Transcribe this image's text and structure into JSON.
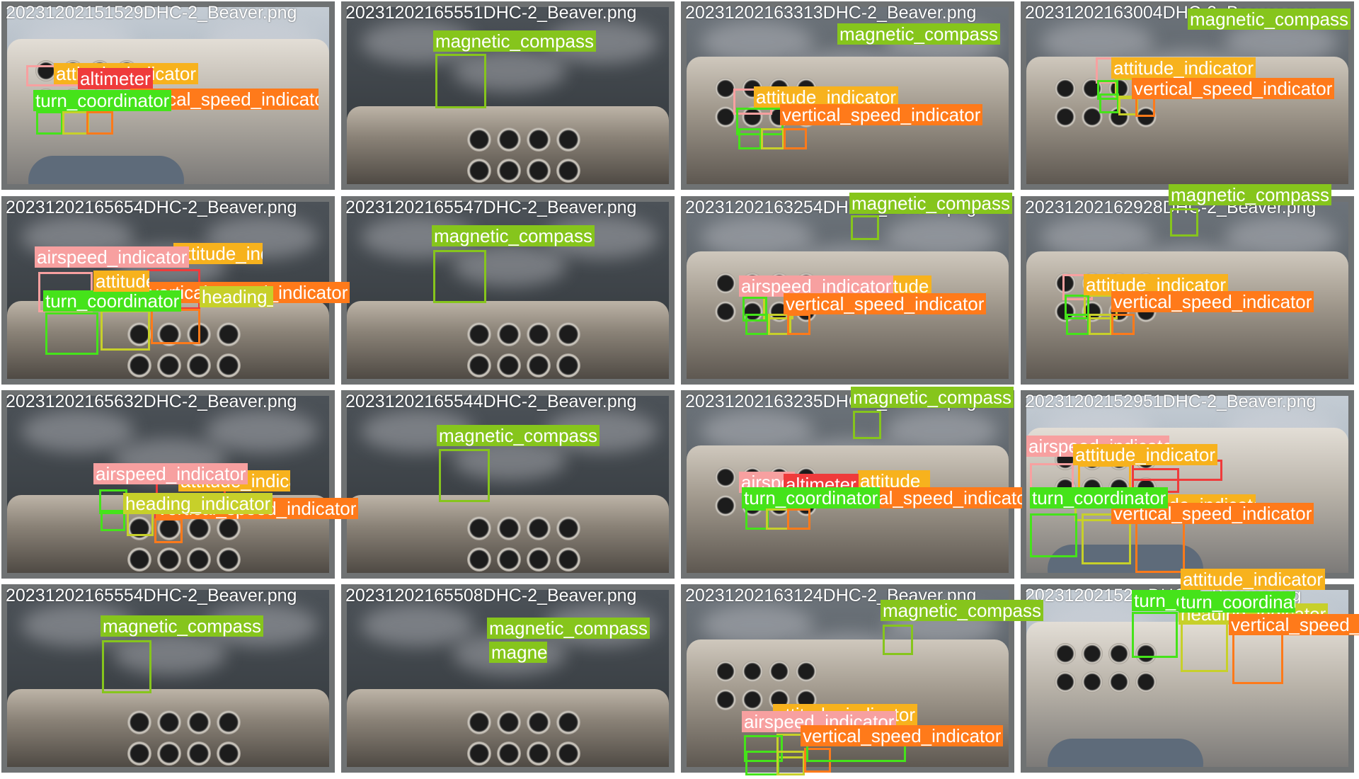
{
  "classes": {
    "airspeed_indicator": {
      "label": "airspeed_indicator",
      "color": "#f7a0a0"
    },
    "altimeter": {
      "label": "altimeter",
      "color": "#ef3b3b"
    },
    "attitude_indicator": {
      "label": "attitude_indicator",
      "color": "#f7b21d"
    },
    "heading_indicator": {
      "label": "heading_indicator",
      "color": "#c7d02a"
    },
    "magnetic_compass": {
      "label": "magnetic_compass",
      "color": "#86c51c"
    },
    "turn_coordinator": {
      "label": "turn_coordinator",
      "color": "#45e31a"
    },
    "vertical_speed_indicator": {
      "label": "vertical_speed_indicator",
      "color": "#ff7a1a"
    }
  },
  "tiles": [
    {
      "filename": "20231202151529DHC-2_Beaver.png",
      "theme": "snow"
    },
    {
      "filename": "20231202165551DHC-2_Beaver.png",
      "theme": "dark"
    },
    {
      "filename": "20231202163313DHC-2_Beaver.png",
      "theme": "clouds"
    },
    {
      "filename": "20231202163004DHC-2_Beaver.png",
      "theme": "clouds"
    },
    {
      "filename": "20231202165654DHC-2_Beaver.png",
      "theme": "dark"
    },
    {
      "filename": "20231202165547DHC-2_Beaver.png",
      "theme": "dark"
    },
    {
      "filename": "20231202163254DHC-2_Beaver.png",
      "theme": "clouds"
    },
    {
      "filename": "20231202162928DHC-2_Beaver.png",
      "theme": "clouds"
    },
    {
      "filename": "20231202165632DHC-2_Beaver.png",
      "theme": "dark"
    },
    {
      "filename": "20231202165544DHC-2_Beaver.png",
      "theme": "dark"
    },
    {
      "filename": "20231202163235DHC-2_Beaver.png",
      "theme": "clouds"
    },
    {
      "filename": "20231202152951DHC-2_Beaver.png",
      "theme": "snow"
    },
    {
      "filename": "20231202165554DHC-2_Beaver.png",
      "theme": "dark"
    },
    {
      "filename": "20231202165508DHC-2_Beaver.png",
      "theme": "dark"
    },
    {
      "filename": "20231202163124DHC-2_Beaver.png",
      "theme": "clouds"
    },
    {
      "filename": "20231202152...DHC-2_Beaver.png",
      "theme": "snow"
    }
  ]
}
